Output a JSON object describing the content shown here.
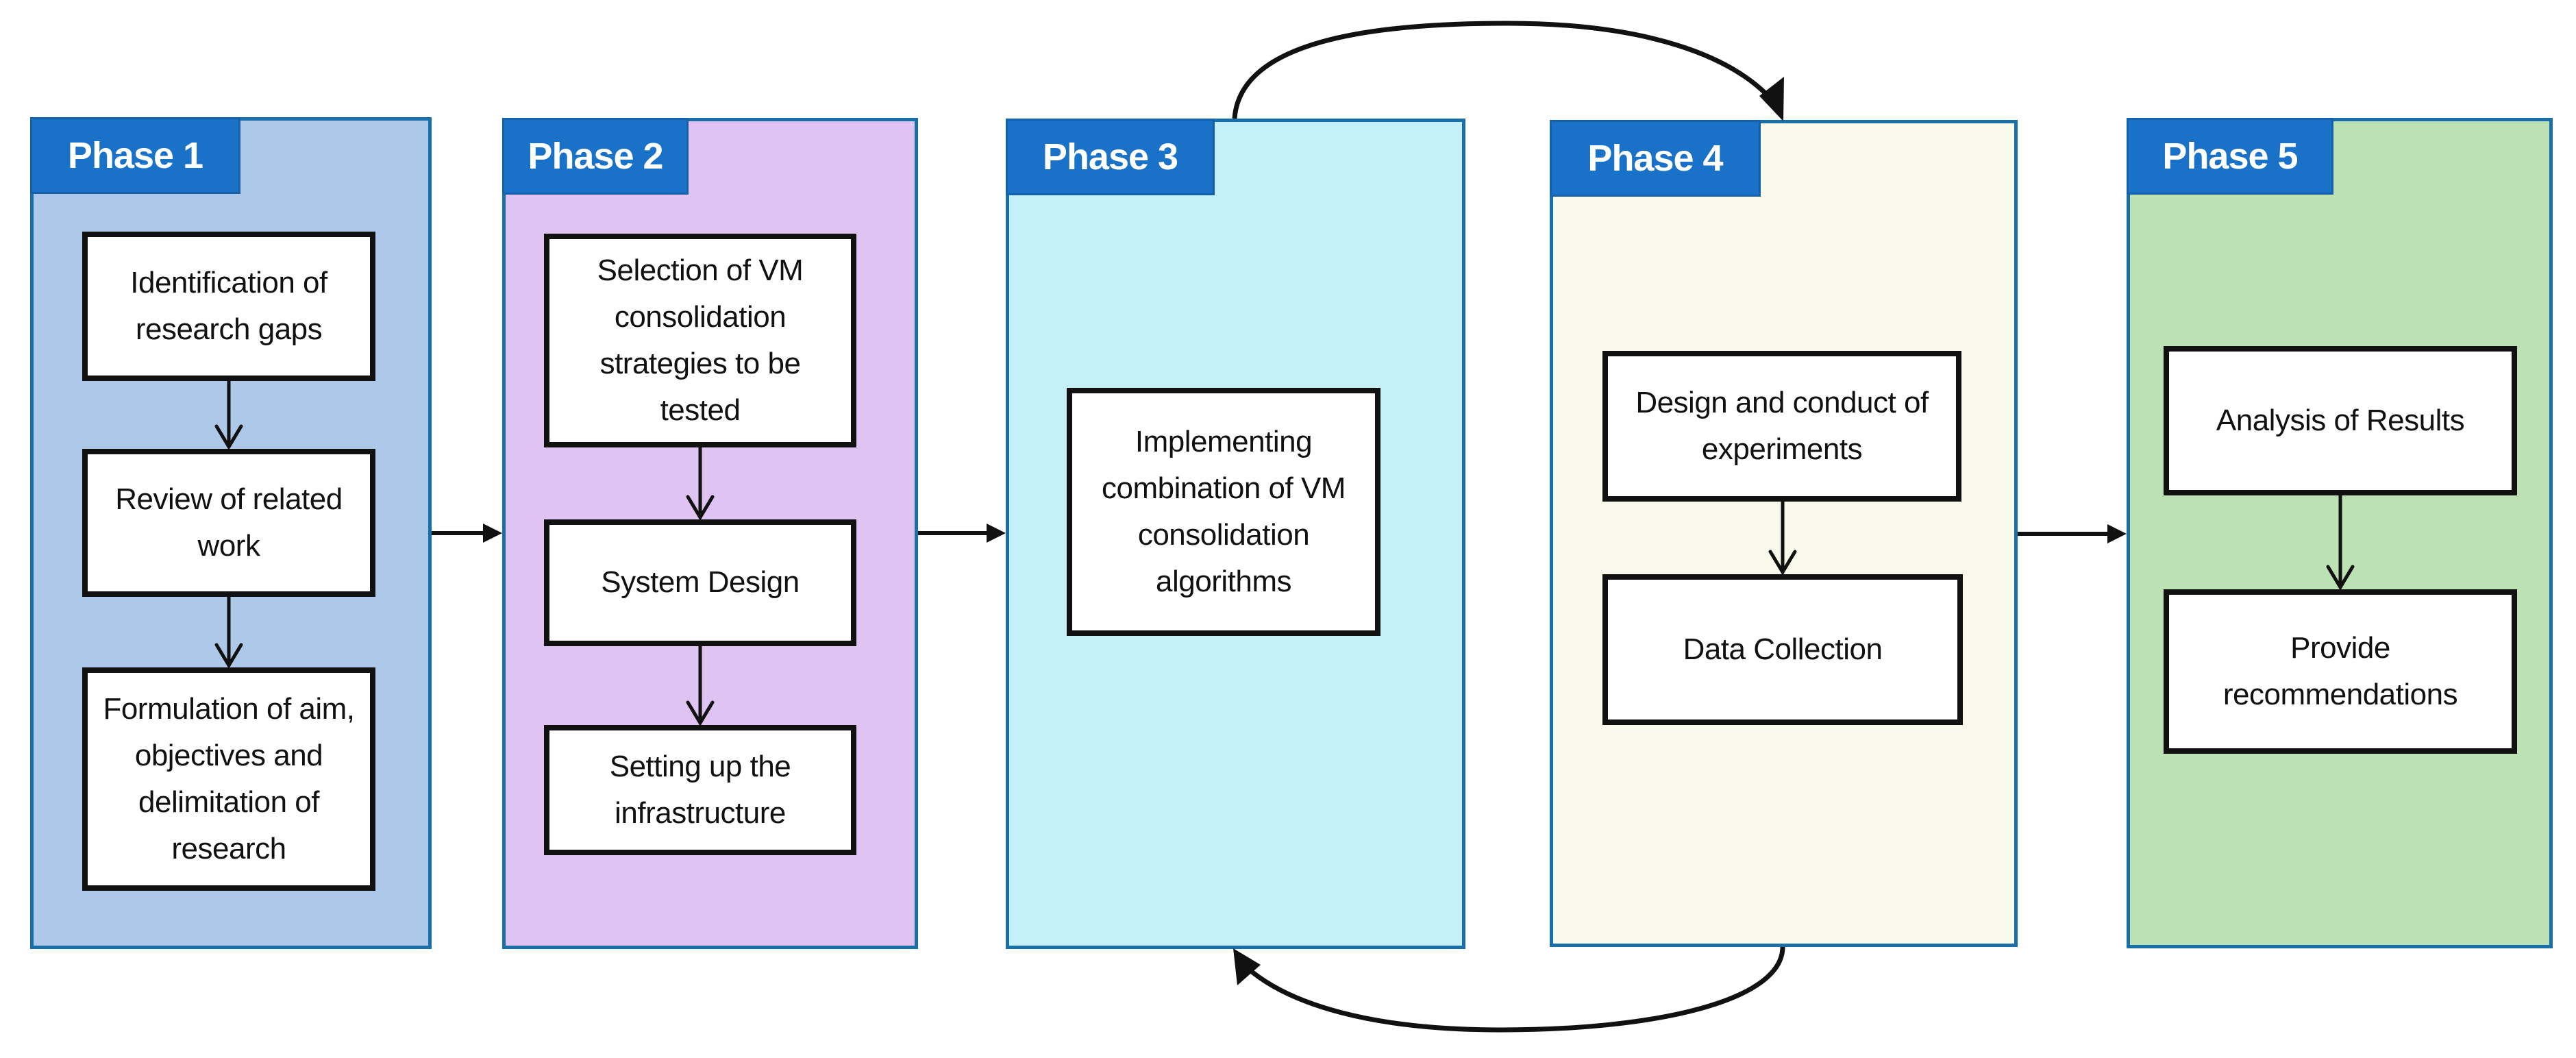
{
  "diagram": {
    "colors": {
      "tab": "#1a72c8",
      "border": "#1b6fa8",
      "phase1": "#adc8e8",
      "phase2": "#dfc3f3",
      "phase3": "#c5f0f8",
      "phase4": "#f9faec",
      "phase5": "#bbe1b4"
    },
    "phases": [
      {
        "label": "Phase 1",
        "steps": [
          "Identification of research gaps",
          "Review of related work",
          "Formulation of aim,  objectives and delimitation of research"
        ]
      },
      {
        "label": "Phase 2",
        "steps": [
          "Selection of VM consolidation strategies to be tested",
          "System Design",
          "Setting up the infrastructure"
        ]
      },
      {
        "label": "Phase 3",
        "steps": [
          "Implementing combination of VM consolidation algorithms"
        ]
      },
      {
        "label": "Phase 4",
        "steps": [
          "Design and conduct of experiments",
          "Data Collection"
        ]
      },
      {
        "label": "Phase 5",
        "steps": [
          "Analysis of Results",
          "Provide recommendations"
        ]
      }
    ],
    "connections": [
      {
        "from": "Phase 1",
        "to": "Phase 2"
      },
      {
        "from": "Phase 2",
        "to": "Phase 3"
      },
      {
        "from": "Phase 3",
        "to": "Phase 4"
      },
      {
        "from": "Phase 4",
        "to": "Phase 3"
      },
      {
        "from": "Phase 4",
        "to": "Phase 5"
      }
    ]
  }
}
